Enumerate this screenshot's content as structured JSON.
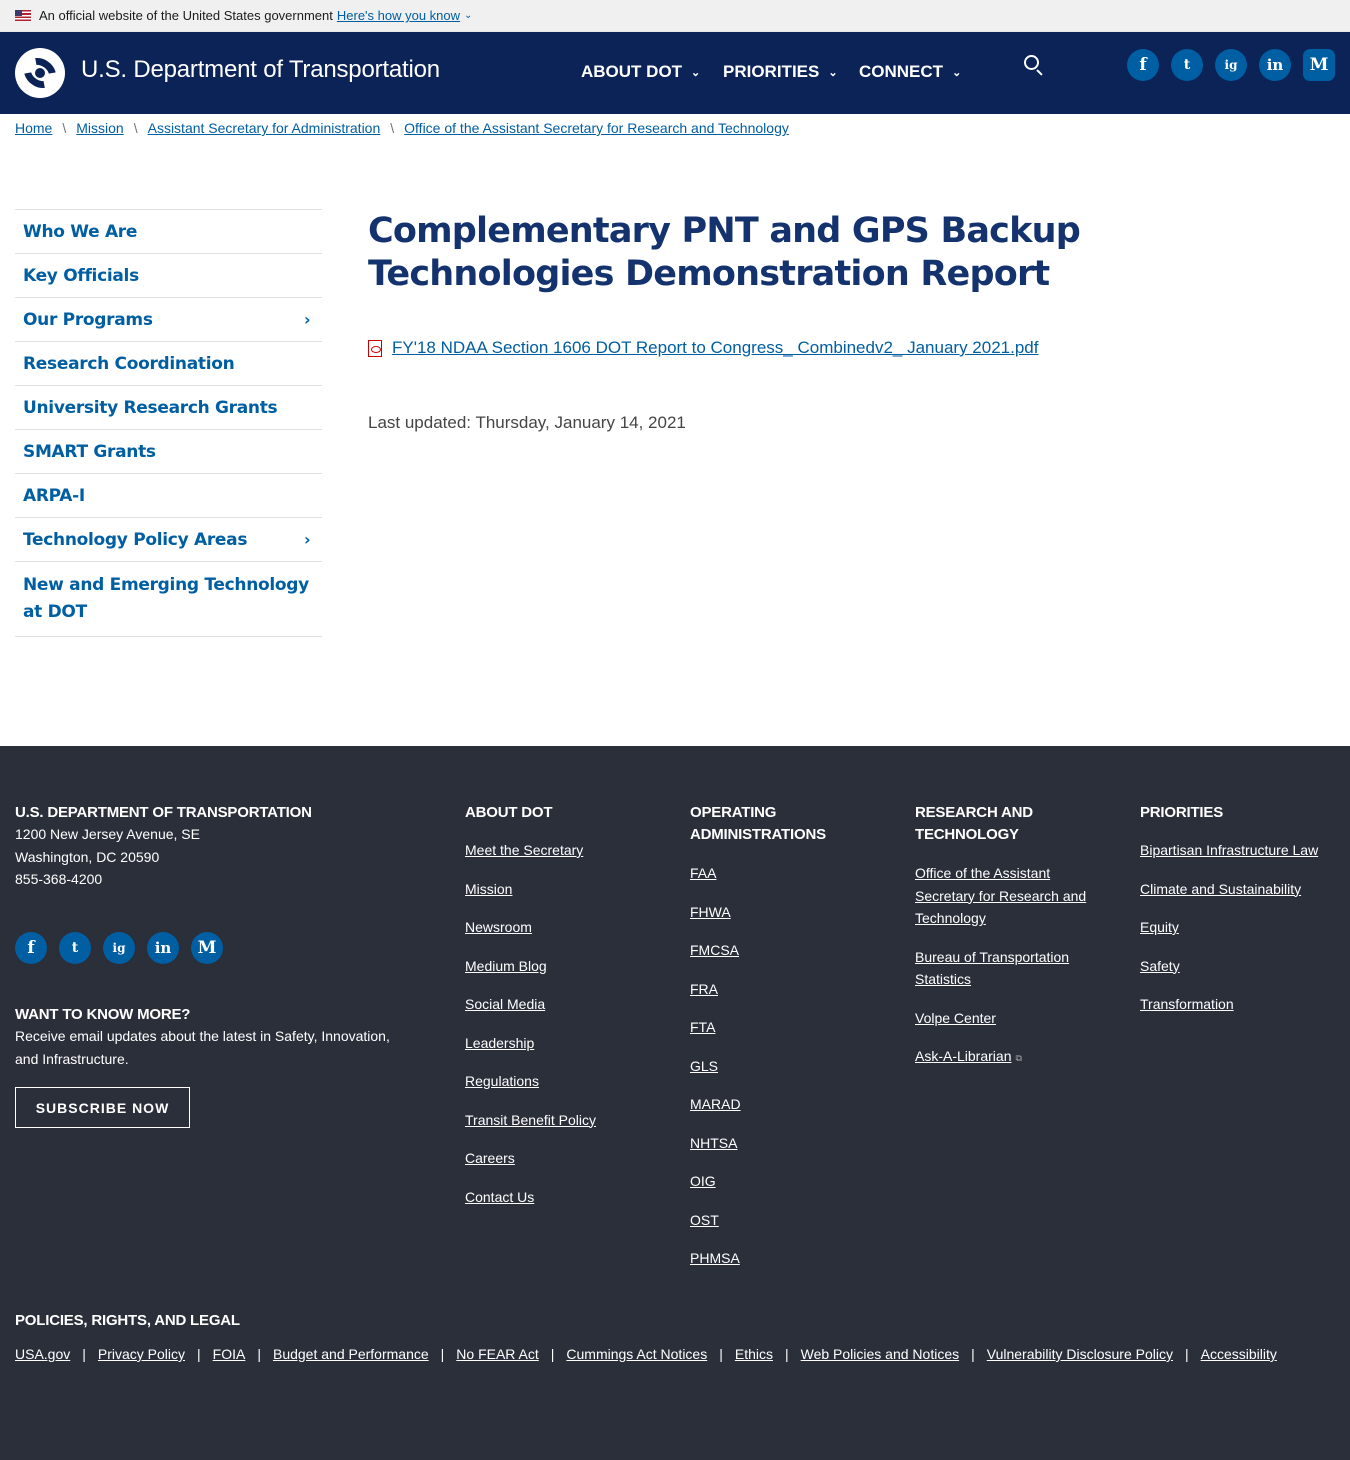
{
  "gov_banner": {
    "text": "An official website of the United States government",
    "link": "Here's how you know"
  },
  "header": {
    "title": "U.S. Department of Transportation",
    "nav": [
      "ABOUT DOT",
      "PRIORITIES",
      "CONNECT"
    ],
    "social": [
      "f",
      "t",
      "ig",
      "in",
      "M"
    ]
  },
  "breadcrumb": [
    "Home",
    "Mission",
    "Assistant Secretary for Administration",
    "Office of the Assistant Secretary for Research and Technology"
  ],
  "sidenav": [
    {
      "label": "Who We Are"
    },
    {
      "label": "Key Officials"
    },
    {
      "label": "Our Programs",
      "expandable": true
    },
    {
      "label": "Research Coordination"
    },
    {
      "label": "University Research Grants"
    },
    {
      "label": "SMART Grants"
    },
    {
      "label": "ARPA-I"
    },
    {
      "label": "Technology Policy Areas",
      "expandable": true
    },
    {
      "label": "New and Emerging Technology at DOT"
    }
  ],
  "main": {
    "title": "Complementary PNT and GPS Backup Technologies Demonstration Report",
    "file_name": "FY'18 NDAA Section 1606 DOT Report to Congress_ Combinedv2_ January 2021.pdf",
    "last_updated": "Last updated: Thursday, January 14, 2021"
  },
  "footer": {
    "org": {
      "heading": "U.S. DEPARTMENT OF TRANSPORTATION",
      "address1": "1200 New Jersey Avenue, SE",
      "address2": "Washington, DC 20590",
      "phone": "855-368-4200"
    },
    "newsletter": {
      "heading": "WANT TO KNOW MORE?",
      "text": "Receive email updates about the latest in Safety, Innovation, and Infrastructure.",
      "button": "SUBSCRIBE NOW"
    },
    "about": {
      "heading": "ABOUT DOT",
      "links": [
        "Meet the Secretary",
        "Mission",
        "Newsroom",
        "Medium Blog",
        "Social Media",
        "Leadership",
        "Regulations",
        "Transit Benefit Policy",
        "Careers",
        "Contact Us"
      ]
    },
    "operating": {
      "heading": "OPERATING ADMINISTRATIONS",
      "links": [
        "FAA",
        "FHWA",
        "FMCSA",
        "FRA",
        "FTA",
        "GLS",
        "MARAD",
        "NHTSA",
        "OIG",
        "OST",
        "PHMSA"
      ]
    },
    "research": {
      "heading": "RESEARCH AND TECHNOLOGY",
      "links": [
        "Office of the Assistant Secretary for Research and Technology",
        "Bureau of Transportation Statistics",
        "Volpe Center",
        "Ask-A-Librarian"
      ]
    },
    "priorities": {
      "heading": "PRIORITIES",
      "links": [
        "Bipartisan Infrastructure Law",
        "Climate and Sustainability",
        "Equity",
        "Safety",
        "Transformation"
      ]
    },
    "legal": {
      "heading": "POLICIES, RIGHTS, AND LEGAL",
      "links": [
        "USA.gov",
        "Privacy Policy",
        "FOIA",
        "Budget and Performance",
        "No FEAR Act",
        "Cummings Act Notices",
        "Ethics",
        "Web Policies and Notices",
        "Vulnerability Disclosure Policy",
        "Accessibility"
      ]
    }
  }
}
